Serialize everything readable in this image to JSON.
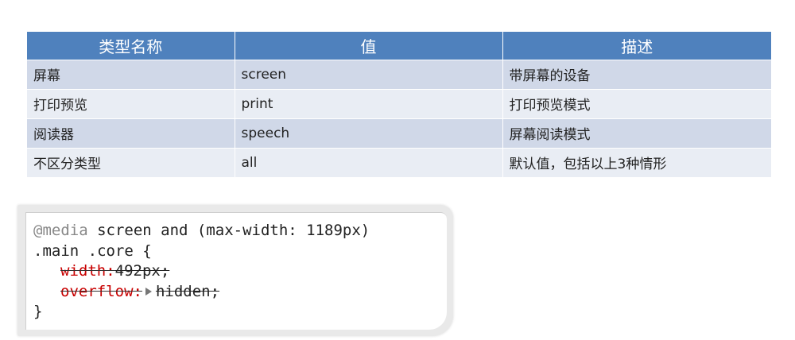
{
  "table": {
    "headers": [
      "类型名称",
      "值",
      "描述"
    ],
    "rows": [
      [
        "屏幕",
        "screen",
        "带屏幕的设备"
      ],
      [
        "打印预览",
        "print",
        "打印预览模式"
      ],
      [
        "阅读器",
        "speech",
        "屏幕阅读模式"
      ],
      [
        "不区分类型",
        "all",
        "默认值，包括以上3种情形"
      ]
    ],
    "colors": {
      "header_bg": "#4f81bd",
      "row_odd_bg": "#d0d8e8",
      "row_even_bg": "#e9edf4"
    }
  },
  "code": {
    "at_keyword": "@media",
    "query": " screen and (max-width: 1189px)",
    "selector": ".main .core {",
    "declarations": [
      {
        "property": "width:",
        "value": "492px;"
      },
      {
        "property": "overflow:",
        "value": "hidden;"
      }
    ],
    "closing": "}",
    "colors": {
      "at_keyword": "#888888",
      "struck_property": "#c80000"
    }
  }
}
